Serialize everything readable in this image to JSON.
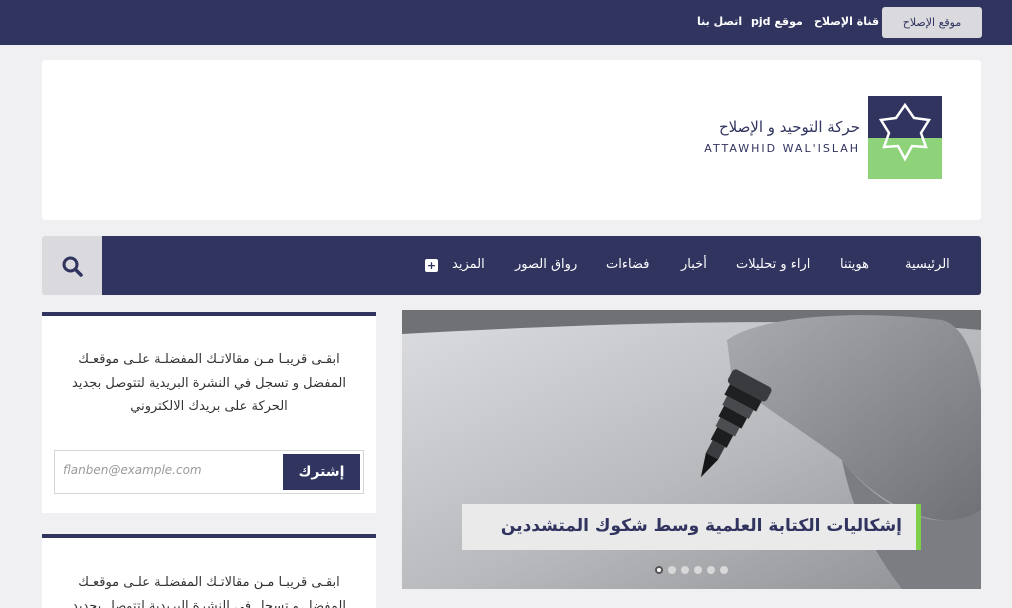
{
  "topbar": {
    "primary_button": "موقع الإصلاح",
    "links": [
      "قناة الإصلاح",
      "موقع pjd",
      "اتصل بنا"
    ]
  },
  "logo": {
    "arabic_name": "حركة التوحيد و الإصلاح",
    "latin_name": "ATTAWHID WAL'ISLAH"
  },
  "nav": {
    "items": [
      "الرئيسية",
      "هويتنا",
      "اراء و تحليلات",
      "أخبار",
      "فضاءات",
      "رواق الصور",
      "المزيد"
    ],
    "more_icon": "plus-icon",
    "search_icon": "search-icon"
  },
  "slider": {
    "caption": "إشكاليات الكتابة العلمية وسط شكوك المتشددين",
    "dots": 6,
    "active_dot": 6
  },
  "newsletter": {
    "text_line1": "ابقـى قريبـا مـن مقالاتـك المفضلـة علـى موقعـك",
    "text_line2": "المفضل و تسجل في النشرة البريدية لتتوصل بجديد",
    "text_line3": "الحركة على بريدك الالكتروني",
    "email_placeholder": "flanben@example.com",
    "subscribe_label": "إشترك"
  },
  "colors": {
    "primary": "#30345f",
    "accent_green": "#7fcf4a",
    "light_gray": "#d9d9de"
  }
}
